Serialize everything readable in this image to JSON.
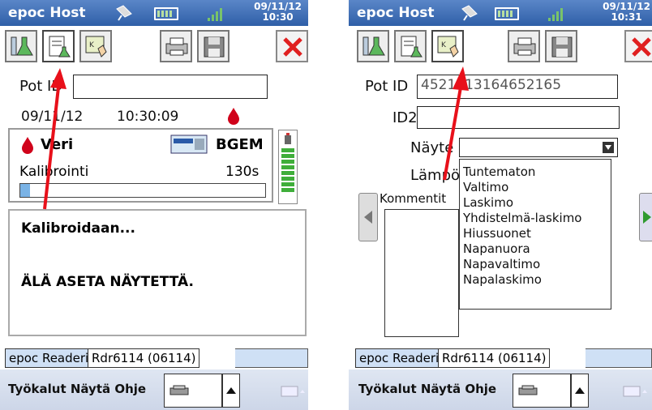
{
  "left": {
    "app_title": "epoc Host",
    "clock_date": "09/11/12",
    "clock_time": "10:30",
    "pot_id_label": "Pot ID",
    "pot_id_value": "",
    "test_date": "09/11/12",
    "test_time": "10:30:09",
    "sample_type": "Veri",
    "card_type": "BGEM",
    "calibration_label": "Kalibrointi",
    "calibration_time": "130s",
    "calibration_progress_fraction": 0.04,
    "message_title": "Kalibroidaan...",
    "message_body": "ÄLÄ ASETA NÄYTETTÄ.",
    "reader_tab": "epoc Readerit",
    "reader_id": "Rdr6114 (06114)",
    "menu": "Työkalut Näytä Ohje"
  },
  "right": {
    "app_title": "epoc Host",
    "clock_date": "09/11/12",
    "clock_time": "10:31",
    "pot_id_label": "Pot ID",
    "pot_id_value": "4521313164652165",
    "id2_label": "ID2",
    "id2_value": "",
    "sample_label": "Näyte",
    "temp_label": "Lämpö",
    "comments_label": "Kommentit",
    "sample_options": [
      "Tuntematon",
      "Valtimo",
      "Laskimo",
      "Yhdistelmä-laskimo",
      "Hiussuonet",
      "Napanuora",
      "Napavaltimo",
      "Napalaskimo"
    ],
    "reader_tab": "epoc Readerit",
    "reader_id": "Rdr6114 (06114)",
    "menu": "Työkalut Näytä Ohje"
  },
  "colors": {
    "titlebar": "#3d6cb4",
    "blood_drop": "#d0021b",
    "arrow": "#e8101a",
    "battery_bar": "#3fae3a"
  },
  "icons": [
    "flask-icon",
    "document-icon",
    "keyboard-hand-icon",
    "printer-icon",
    "save-icon",
    "close-icon",
    "blood-drop-icon",
    "card-icon",
    "battery-icon",
    "keyboard-icon"
  ]
}
